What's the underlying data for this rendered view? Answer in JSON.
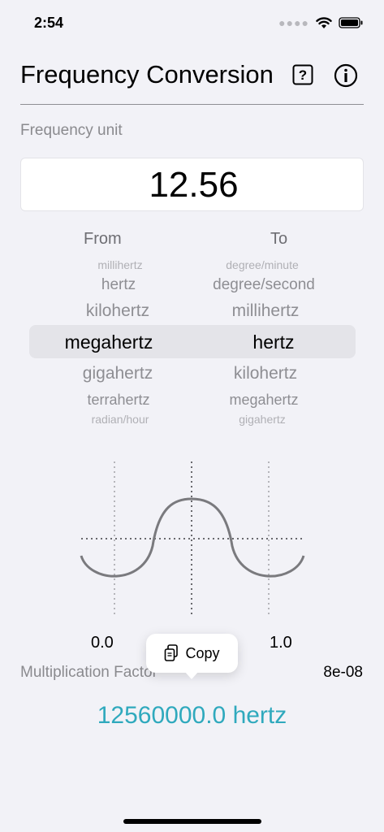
{
  "status": {
    "time": "2:54"
  },
  "header": {
    "title": "Frequency Conversion"
  },
  "input": {
    "label": "Frequency unit",
    "value": "12.56"
  },
  "picker": {
    "from_label": "From",
    "to_label": "To",
    "from_items": [
      "millihertz",
      "hertz",
      "kilohertz",
      "megahertz",
      "gigahertz",
      "terrahertz",
      "radian/hour"
    ],
    "to_items": [
      "degree/minute",
      "degree/second",
      "millihertz",
      "hertz",
      "kilohertz",
      "megahertz",
      "gigahertz"
    ],
    "from_selected": "megahertz",
    "to_selected": "hertz"
  },
  "chart": {
    "tick_left": "0.0",
    "tick_right": "1.0"
  },
  "multiplication": {
    "label": "Multiplication Factor",
    "value": "8e-08"
  },
  "copy_menu": {
    "label": "Copy"
  },
  "result": {
    "text": "12560000.0 hertz"
  },
  "colors": {
    "accent": "#2fa9bd",
    "background": "#f2f2f7"
  }
}
